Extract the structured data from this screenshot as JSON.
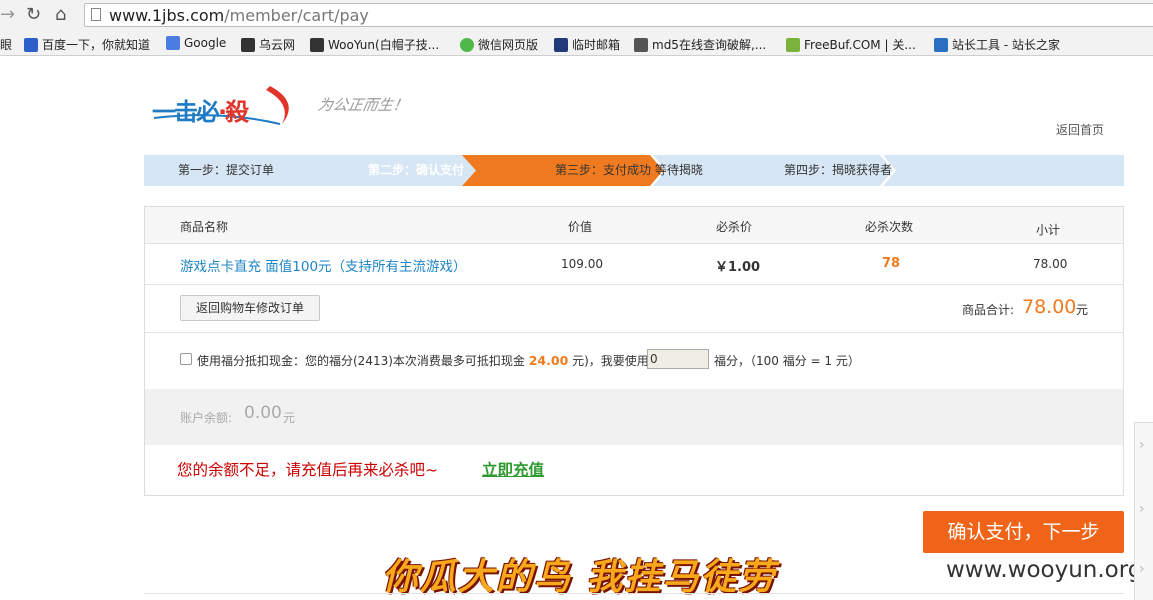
{
  "browser": {
    "url_host": "www.1jbs.com",
    "url_path": "/member/cart/pay",
    "bookmarks": [
      {
        "label": "眼",
        "color": "#cccccc"
      },
      {
        "label": "百度一下，你就知道",
        "color": "#2b5fc9"
      },
      {
        "label": "Google",
        "color": "#4a7de0"
      },
      {
        "label": "乌云网",
        "color": "#333333"
      },
      {
        "label": "WooYun(白帽子技...",
        "color": "#333333"
      },
      {
        "label": "微信网页版",
        "color": "#4fb848"
      },
      {
        "label": "临时邮箱",
        "color": "#223a7a"
      },
      {
        "label": "md5在线查询破解,...",
        "color": "#555555"
      },
      {
        "label": "FreeBuf.COM | 关...",
        "color": "#7bb33a"
      },
      {
        "label": "站长工具 - 站长之家",
        "color": "#2a6fc0"
      }
    ]
  },
  "header": {
    "logo_part1": "一击必",
    "logo_dot": "·",
    "logo_part2": "殺",
    "slogan": "为公正而生！",
    "back_home": "返回首页"
  },
  "steps": [
    {
      "label": "第一步：提交订单",
      "active": false
    },
    {
      "label": "第二步：确认支付",
      "active": true
    },
    {
      "label": "第三步：支付成功 等待揭晓",
      "active": false
    },
    {
      "label": "第四步：揭晓获得者",
      "active": false
    }
  ],
  "table": {
    "headers": [
      "商品名称",
      "价值",
      "必杀价",
      "必杀次数",
      "小计"
    ],
    "item": {
      "name": "游戏点卡直充 面值100元（支持所有主流游戏）",
      "value": "109.00",
      "price": "￥1.00",
      "count": "78",
      "subtotal": "78.00"
    }
  },
  "cart": {
    "back_button": "返回购物车修改订单",
    "total_label": "商品合计:",
    "total_value": "78.00",
    "total_unit": "元"
  },
  "points": {
    "text_before": "使用福分抵扣现金：您的福分(2413)本次消费最多可抵扣现金",
    "max_amount": "24.00",
    "text_mid": "元)，我要使用",
    "input_value": "0",
    "text_after": "福分，（100 福分 = 1 元）"
  },
  "balance": {
    "label": "账户余额:",
    "value": "0.00",
    "unit": "元"
  },
  "warning": {
    "message": "您的余额不足，请充值后再来必杀吧~",
    "link": "立即充值"
  },
  "confirm_button": "确认支付，下一步",
  "banner_text": "你瓜大的鸟 我挂马徒劳",
  "watermark": "www.wooyun.org",
  "colors": {
    "accent": "#f07a1f",
    "link": "#1e86c6",
    "warning": "#cc0000",
    "steps_bg": "#d7e6f4"
  }
}
